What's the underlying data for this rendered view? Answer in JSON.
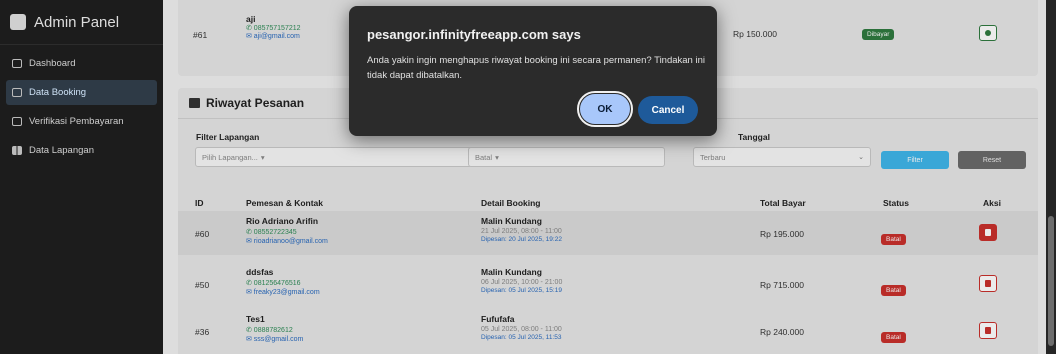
{
  "sidebar": {
    "brand": "Admin Panel",
    "items": [
      {
        "label": "Dashboard",
        "icon": "dashboard-icon"
      },
      {
        "label": "Data Booking",
        "icon": "calendar-icon"
      },
      {
        "label": "Verifikasi Pembayaran",
        "icon": "card-icon"
      },
      {
        "label": "Data Lapangan",
        "icon": "grid-icon"
      }
    ]
  },
  "top_row": {
    "id": "#61",
    "name": "aji",
    "phone": "✆ 085757157212",
    "email": "✉ aji@gmail.com",
    "price": "Rp 150.000",
    "status": "Dibayar"
  },
  "section": {
    "title": "Riwayat Pesanan",
    "filter_label": "Filter Lapangan",
    "filter_placeholder": "Pilih Lapangan...",
    "status_value": "Batal",
    "sort_label": "Tanggal",
    "sort_value": "Terbaru",
    "btn_filter": "Filter",
    "btn_reset": "Reset"
  },
  "table": {
    "headers": [
      "ID",
      "Pemesan & Kontak",
      "Detail Booking",
      "Total Bayar",
      "Status",
      "Aksi"
    ],
    "rows": [
      {
        "id": "#60",
        "name": "Rio Adriano Arifin",
        "phone": "✆ 08552722345",
        "email": "✉ rioadrianoo@gmail.com",
        "venue": "Malin Kundang",
        "date": "21 Jul 2025, 08:00 - 11:00",
        "booked": "Dipesan: 20 Jul 2025, 19:22",
        "price": "Rp 195.000",
        "status": "Batal"
      },
      {
        "id": "#50",
        "name": "ddsfas",
        "phone": "✆ 081256476516",
        "email": "✉ freaky23@gmail.com",
        "venue": "Malin Kundang",
        "date": "06 Jul 2025, 10:00 - 21:00",
        "booked": "Dipesan: 05 Jul 2025, 15:19",
        "price": "Rp 715.000",
        "status": "Batal"
      },
      {
        "id": "#36",
        "name": "Tes1",
        "phone": "✆ 0888782612",
        "email": "✉ sss@gmail.com",
        "venue": "Fufufafa",
        "date": "05 Jul 2025, 08:00 - 11:00",
        "booked": "Dipesan: 05 Jul 2025, 11:53",
        "price": "Rp 240.000",
        "status": "Batal"
      }
    ]
  },
  "dialog": {
    "title": "pesangor.infinityfreeapp.com says",
    "message": "Anda yakin ingin menghapus riwayat booking ini secara permanen? Tindakan ini tidak dapat dibatalkan.",
    "ok": "OK",
    "cancel": "Cancel"
  },
  "colors": {
    "accent": "#a8c7fa",
    "danger": "#c9302c",
    "success": "#2f7a3f",
    "info": "#3fb6ea"
  }
}
